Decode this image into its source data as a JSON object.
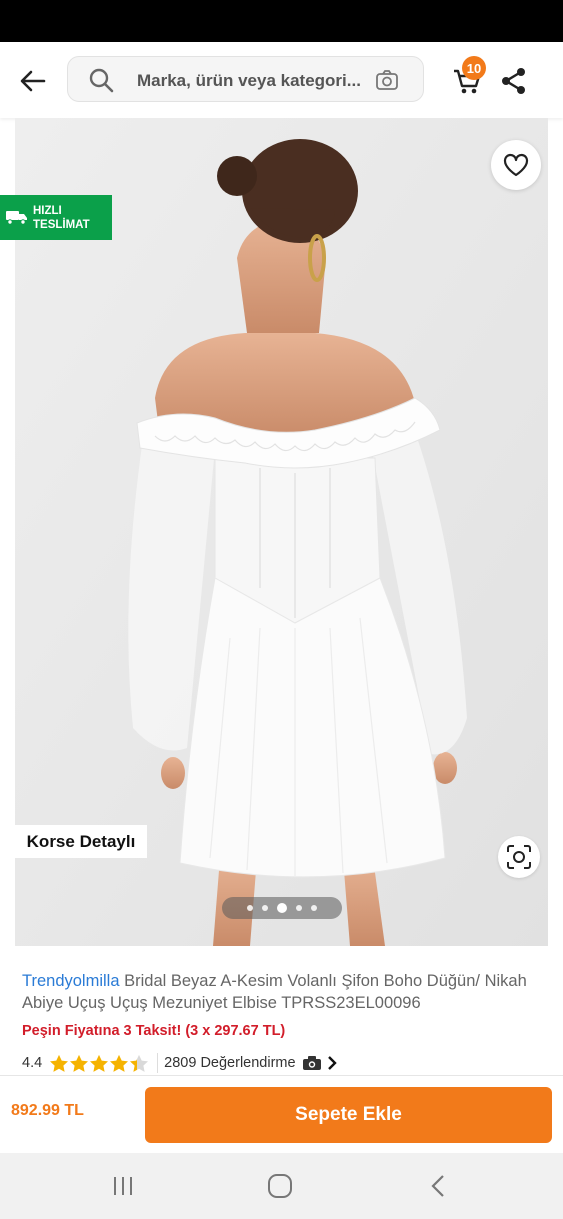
{
  "search": {
    "placeholder": "Marka, ürün veya kategori..."
  },
  "cart": {
    "count": "10"
  },
  "icons": {
    "back": "arrow-left-icon",
    "search": "search-icon",
    "camera": "camera-search-icon",
    "cart": "cart-icon",
    "share": "share-icon",
    "favorite": "heart-icon",
    "truck": "truck-icon",
    "visual_search": "visual-search-icon"
  },
  "colors": {
    "accent": "#f27a1a",
    "fast_delivery": "#0ba04a",
    "brand": "#2a7bd6",
    "installment": "#d21d2a"
  },
  "gallery": {
    "fast_delivery_line1": "HIZLI",
    "fast_delivery_line2": "TESLİMAT",
    "feature_tag": "Korse Detaylı",
    "dot_count": 5,
    "active_index": 2
  },
  "product": {
    "brand": "Trendyolmilla",
    "name": "Bridal Beyaz A-Kesim Volanlı Şifon Boho Düğün/ Nikah Abiye Uçuş Uçuş Mezuniyet Elbise TPRSS23EL00096",
    "installment": "Peşin Fiyatına 3 Taksit! (3 x 297.67 TL)",
    "rating": "4.4",
    "rating_value": 4.4,
    "review_count": "2809 Değerlendirme"
  },
  "bottom": {
    "price": "892.99 TL",
    "add_to_cart": "Sepete Ekle"
  },
  "nav": {
    "recent": "recent-apps-icon",
    "home": "home-icon",
    "back": "back-nav-icon"
  }
}
